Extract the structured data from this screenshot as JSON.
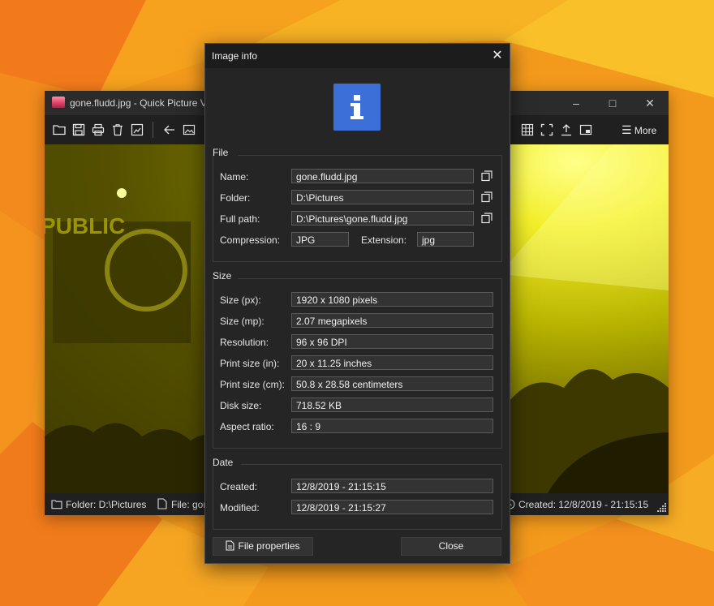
{
  "viewer": {
    "title": "gone.fludd.jpg - Quick Picture V",
    "more_label": "More",
    "status": {
      "folder": "Folder: D:\\Pictures",
      "file": "File: gor",
      "created": "Created: 12/8/2019 - 21:15:15"
    },
    "photo_banner_text": "PUBLIC"
  },
  "dialog": {
    "title": "Image info",
    "file_group": {
      "label": "File",
      "name_label": "Name:",
      "name_value": "gone.fludd.jpg",
      "folder_label": "Folder:",
      "folder_value": "D:\\Pictures",
      "fullpath_label": "Full path:",
      "fullpath_value": "D:\\Pictures\\gone.fludd.jpg",
      "compression_label": "Compression:",
      "compression_value": "JPG",
      "extension_label": "Extension:",
      "extension_value": "jpg"
    },
    "size_group": {
      "label": "Size",
      "rows": [
        {
          "label": "Size (px):",
          "value": "1920 x 1080 pixels"
        },
        {
          "label": "Size (mp):",
          "value": "2.07 megapixels"
        },
        {
          "label": "Resolution:",
          "value": "96 x 96 DPI"
        },
        {
          "label": "Print size (in):",
          "value": "20 x 11.25 inches"
        },
        {
          "label": "Print size (cm):",
          "value": "50.8 x 28.58 centimeters"
        },
        {
          "label": "Disk size:",
          "value": "718.52 KB"
        },
        {
          "label": "Aspect ratio:",
          "value": "16 : 9"
        }
      ]
    },
    "date_group": {
      "label": "Date",
      "created_label": "Created:",
      "created_value": "12/8/2019 - 21:15:15",
      "modified_label": "Modified:",
      "modified_value": "12/8/2019 - 21:15:27"
    },
    "file_properties_label": "File properties",
    "close_label": "Close"
  },
  "colors": {
    "wallpaper": "#f39a1c",
    "dialog_bg": "#252525",
    "field_bg": "#333333",
    "info_icon": "#3c6fd8"
  }
}
